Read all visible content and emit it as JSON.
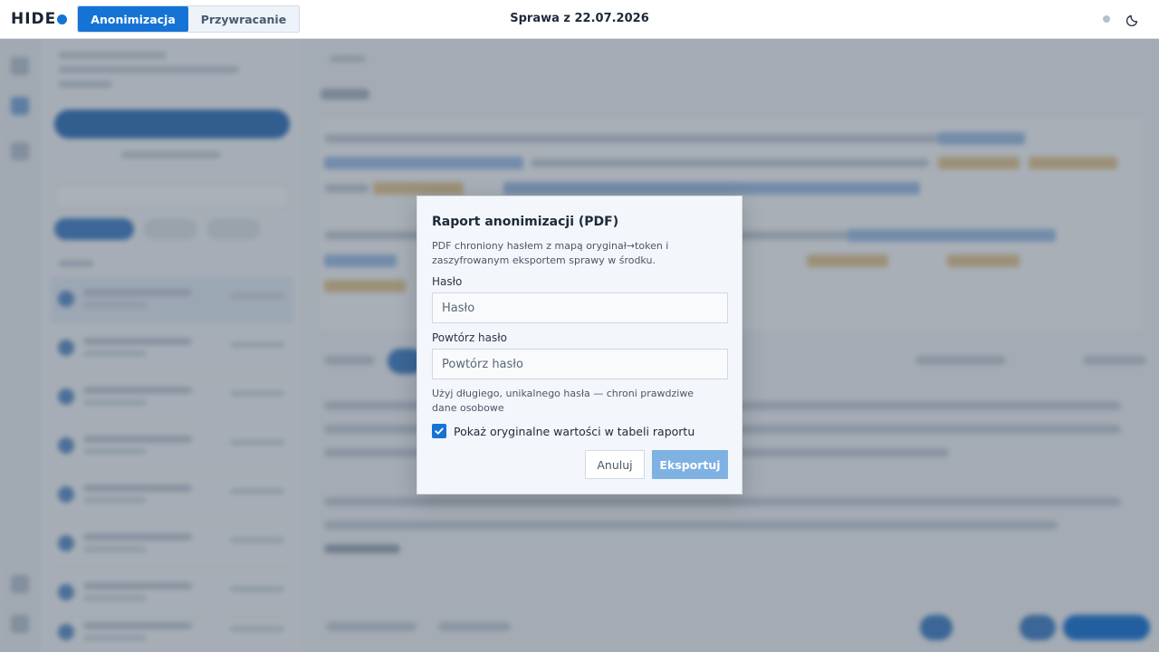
{
  "header": {
    "logo_text": "HIDE",
    "tabs": [
      {
        "label": "Anonimizacja",
        "active": true
      },
      {
        "label": "Przywracanie",
        "active": false
      }
    ],
    "case_title": "Sprawa z 22.07.2026",
    "icons": {
      "status": "status-dot-icon",
      "theme": "moon-icon"
    }
  },
  "modal": {
    "title": "Raport anonimizacji (PDF)",
    "description": "PDF chroniony hasłem z mapą oryginał→token i zaszyfrowanym eksportem sprawy w środku.",
    "password": {
      "label": "Hasło",
      "placeholder": "Hasło",
      "value": ""
    },
    "password_repeat": {
      "label": "Powtórz hasło",
      "placeholder": "Powtórz hasło",
      "value": ""
    },
    "hint": "Użyj długiego, unikalnego hasła — chroni prawdziwe dane osobowe",
    "show_originals": {
      "label": "Pokaż oryginalne wartości w tabeli raportu",
      "checked": true
    },
    "cancel_label": "Anuluj",
    "export_label": "Eksportuj"
  },
  "colors": {
    "accent": "#1673d6",
    "export_button": "#7fb2e3",
    "overlay": "#374456"
  }
}
